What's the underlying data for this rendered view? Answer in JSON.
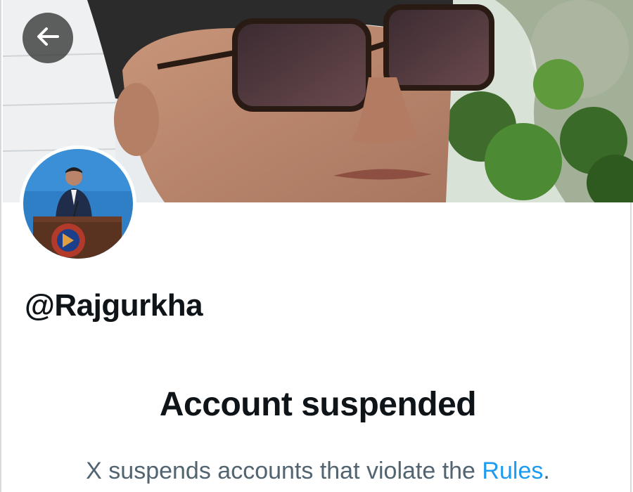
{
  "profile": {
    "handle": "@Rajgurkha",
    "back_icon": "arrow-left-icon"
  },
  "notice": {
    "title": "Account suspended",
    "message_prefix": "X suspends accounts that violate the ",
    "rules_link": "Rules",
    "message_suffix": "."
  },
  "colors": {
    "link": "#1d9bf0",
    "text_primary": "#0f1419",
    "text_secondary": "#536471",
    "back_button_bg": "#3c3c3c"
  }
}
